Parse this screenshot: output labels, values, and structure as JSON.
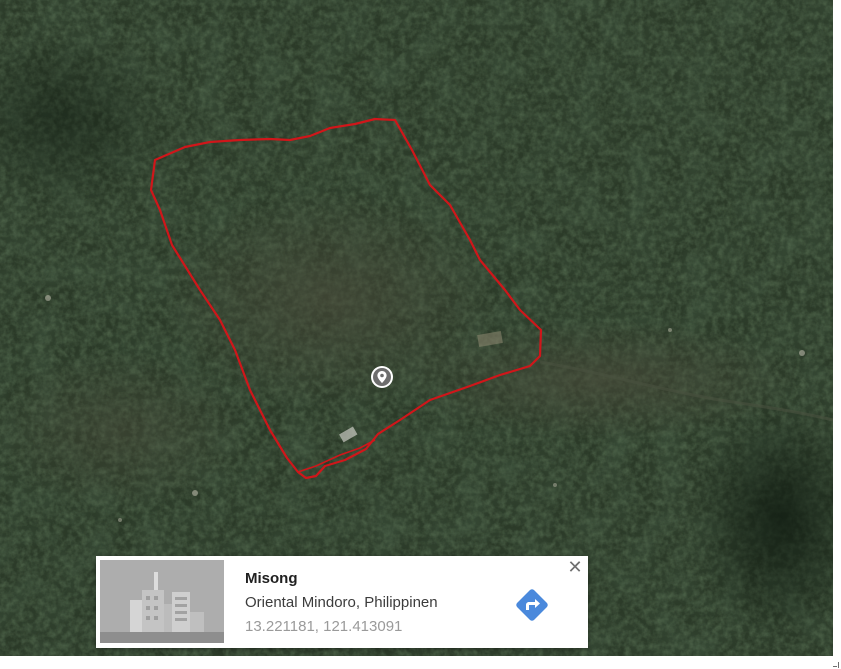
{
  "map": {
    "view": "satellite",
    "pin_icon": "location-pin-icon",
    "boundary_color": "#d0161a"
  },
  "info_card": {
    "title": "Misong",
    "region": "Oriental Mindoro, Philippinen",
    "coordinates": "13.221181, 121.413091",
    "directions_icon": "directions-icon",
    "directions_color": "#4a89dc",
    "close_label": "✕",
    "thumbnail_icon": "building-thumbnail"
  }
}
